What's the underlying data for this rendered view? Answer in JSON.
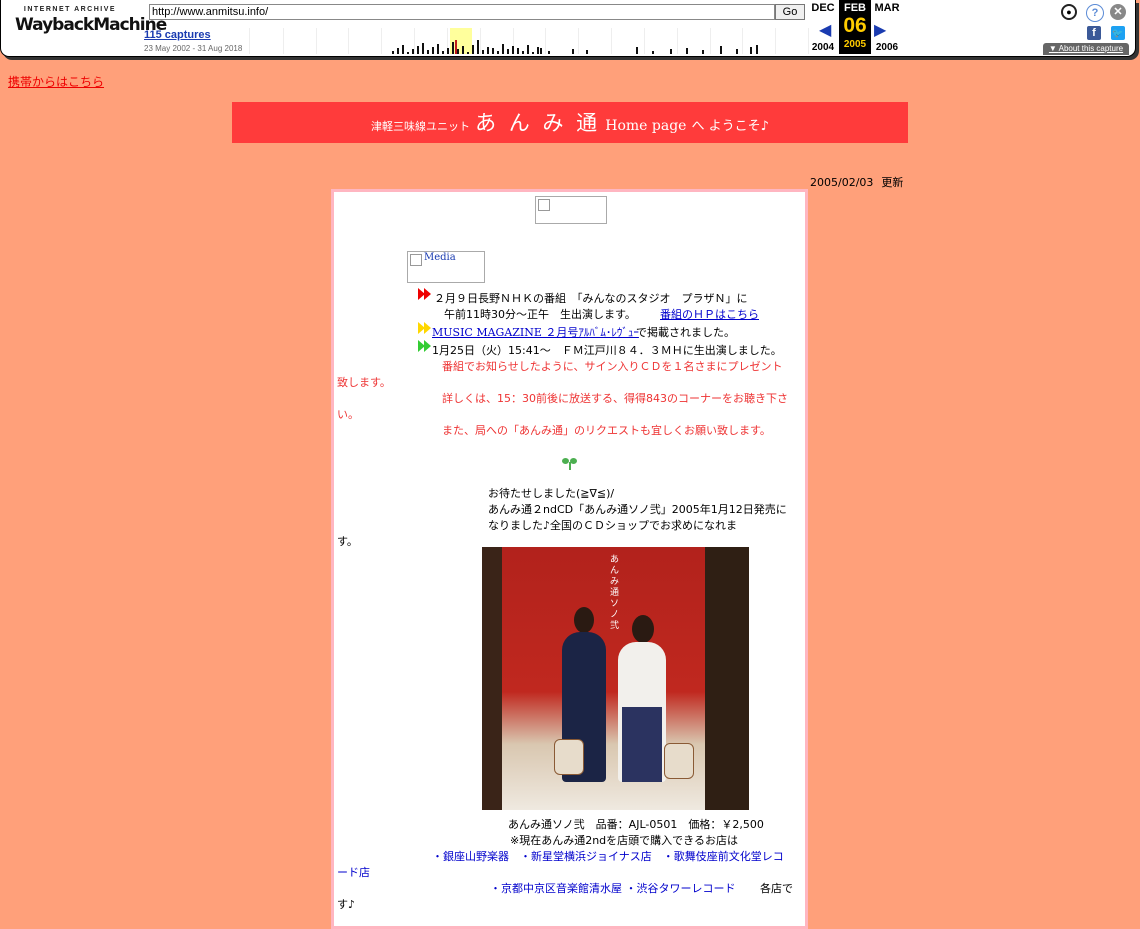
{
  "wayback": {
    "logo_top": "INTERNET ARCHIVE",
    "logo_word1": "Wayback",
    "logo_word2": "Machine",
    "url": "http://www.anmitsu.info/",
    "go_label": "Go",
    "captures": "115 captures",
    "range": "23 May 2002 - 31 Aug 2018",
    "prev_month": "DEC",
    "prev_year": "2004",
    "cur_month": "FEB",
    "cur_day": "06",
    "cur_year": "2005",
    "next_month": "MAR",
    "next_year": "2006",
    "about": "About this capture",
    "icons": [
      "user-icon",
      "help-icon",
      "close-icon",
      "facebook-icon",
      "twitter-icon"
    ]
  },
  "page": {
    "mobile_link": "携帯からはこちら",
    "banner_small": "津軽三味線ユニット",
    "banner_big": "あ ん み 通",
    "banner_mid": "Home page",
    "banner_tail": "へ ようこそ♪",
    "updated_date": "2005/02/03",
    "updated_label": "更新",
    "media_alt": "Media",
    "news1_a": "２月９日長野ＮＨＫの番組　「みんなのスタジオ　プラザＮ」に",
    "news1_b": "午前11時30分～正午　生出演します。",
    "news1_link": "番組のＨＰはこちら",
    "news2_link": "MUSIC MAGAZINE ２月号ｱﾙﾊﾞﾑ･ﾚｳﾞｭｰ",
    "news2_tail": "で掲載されました。",
    "news3": "1月25日（火）15:41～　ＦＭ江戸川８４．３ＭＨに生出演しました。",
    "news3_r1": "番組でお知らせしたように、サイン入りＣＤを１名さまにプレゼント",
    "news3_r1b": "致します。",
    "news3_r2": "詳しくは、15：30前後に放送する、得得843のコーナーをお聴き下さ",
    "news3_r2b": "い。",
    "news3_r3": "また、局への「あんみ通」のリクエストも宜しくお願い致します。",
    "cd_a": "お待たせしました(≧∇≦)/",
    "cd_b": "あんみ通２ndCD「あんみ通ソノ弐」2005年1月12日発売に",
    "cd_c": "なりました♪全国のＣＤショップでお求めになれま",
    "cd_d": "す。",
    "cd_photo_title": "あんみ通ソノ弐",
    "cd_info": "あんみ通ソノ弐　品番：AJL-0501　価格：￥2,500",
    "stores_intro": "※現在あんみ通2ndを店頭で購入できるお店は",
    "stores_1": "・銀座山野楽器　・新星堂横浜ジョイナス店　・歌舞伎座前文化堂レコ",
    "stores_1b": "ード店",
    "stores_2": "・京都中京区音楽館清水屋 ・渋谷タワーレコード",
    "stores_2_tail": "各店で",
    "stores_3": "す♪"
  },
  "colors": {
    "background": "#ffa07a",
    "banner": "#ff3b3b",
    "panel_border": "#ffb6c1",
    "red_text": "#e33333",
    "link_blue": "#0000cc"
  }
}
